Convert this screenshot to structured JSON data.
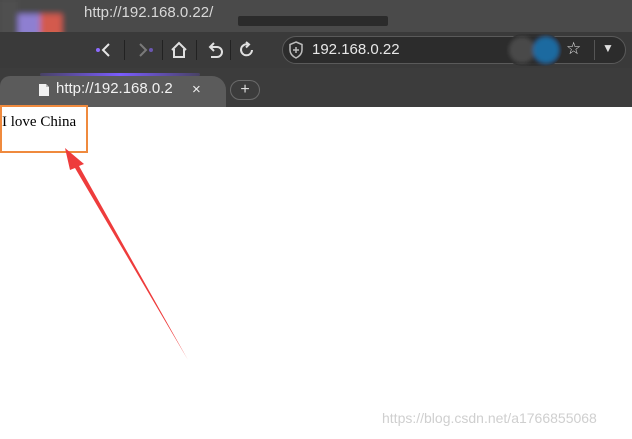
{
  "window": {
    "title": "http://192.168.0.22/"
  },
  "toolbar": {
    "back_icon": "back-icon",
    "forward_icon": "forward-icon",
    "home_icon": "home-icon",
    "undo_icon": "undo-icon",
    "reload_icon": "reload-icon",
    "address": "192.168.0.22",
    "bookmark_icon": "star-icon",
    "menu_icon": "chevron-down-icon"
  },
  "tabs": [
    {
      "label": "http://192.168.0.2",
      "close": "×",
      "active": true
    }
  ],
  "new_tab": "+",
  "page": {
    "text": "I love China"
  },
  "watermark": "https://blog.csdn.net/a1766855068",
  "colors": {
    "highlight_box": "#ef8a3e",
    "arrow": "#ee3c3c",
    "tab_accent": "#7a5cff"
  }
}
